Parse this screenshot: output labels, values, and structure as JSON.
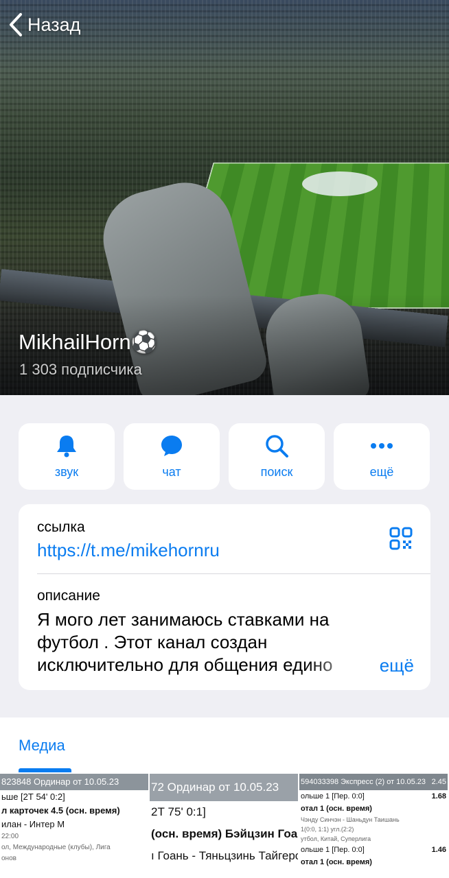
{
  "nav": {
    "back_label": "Назад"
  },
  "channel": {
    "name": "MikhailHorn⚽",
    "subscribers": "1 303 подписчика"
  },
  "actions": [
    {
      "label": "звук",
      "icon": "bell-icon"
    },
    {
      "label": "чат",
      "icon": "chat-bubble-icon"
    },
    {
      "label": "поиск",
      "icon": "search-icon"
    },
    {
      "label": "ещё",
      "icon": "more-dots-icon"
    }
  ],
  "info": {
    "link_caption": "ссылка",
    "link_value": "https://t.me/mikehornru",
    "description_caption": "описание",
    "description_text": "Я мого лет занимаюсь ставками на футбол . Этот канал создан исключительно для общения едино",
    "more_label": "ещё"
  },
  "media": {
    "tab_label": "Медиа",
    "thumbs": [
      {
        "header": "823848  Ординар от 10.05.23",
        "lines": [
          "ьше [2Т 54' 0:2]",
          "л карточек 4.5 (осн. время)",
          "илан - Интер М",
          "22:00",
          "ол, Международные (клубы), Лига",
          "онов"
        ]
      },
      {
        "header": "72  Ординар от 10.05.23",
        "lines": [
          "2Т 75' 0:1]",
          "(осн. время)  Бэйцзин Гоа",
          "ı Гоань - Тяньцзинь Тайгерс"
        ]
      },
      {
        "header": "594033398  Экспресс (2) от 10.05.23",
        "header_right": "2.45",
        "lines": [
          "ольше 1 [Пер. 0:0]",
          "отал 1 (осн. время)",
          "Чэнду Синчэн - Шаньдун Таишань",
          "1(0:0, 1:1) угл.(2:2)",
          "утбол, Китай, Суперлига",
          "ольше 1 [Пер. 0:0]",
          "отал 1 (осн. время)"
        ],
        "odds": [
          "1.68",
          "1.46"
        ]
      }
    ]
  },
  "colors": {
    "accent": "#0a7cf0",
    "background": "#efeff4",
    "card": "#ffffff"
  }
}
